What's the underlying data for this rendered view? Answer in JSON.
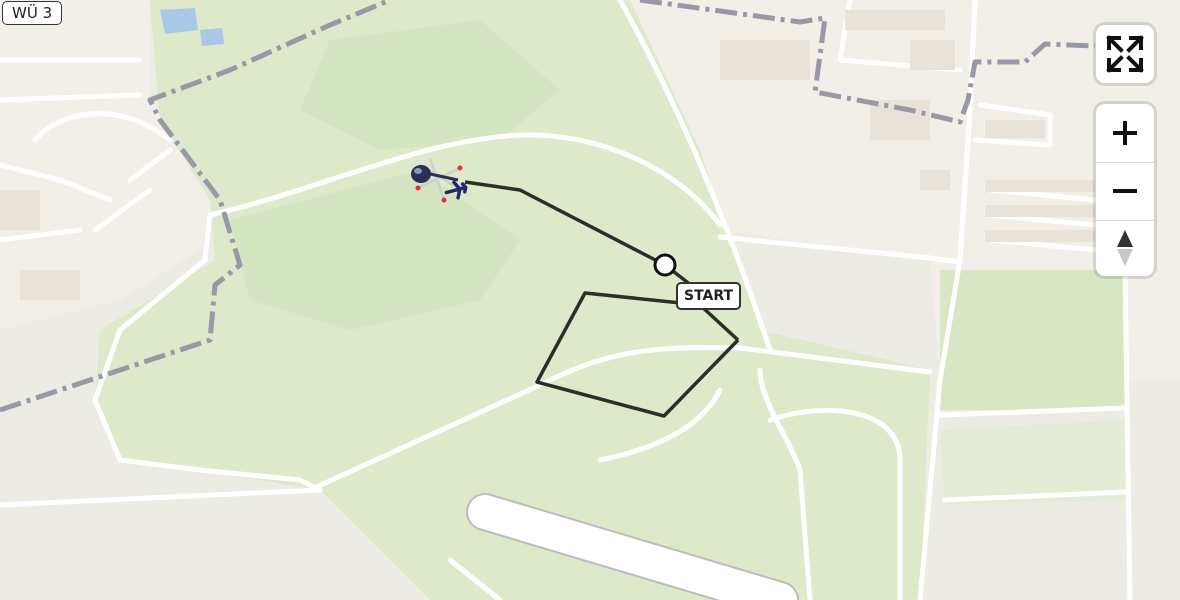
{
  "map": {
    "road_label": "WÜ 3",
    "start_label": "START",
    "colors": {
      "land": "#ecebe4",
      "urban": "#f3efe9",
      "park": "#dde9c9",
      "park_dark": "#d3e3bd",
      "road": "#ffffff",
      "boundary": "#9696a6",
      "track": "#2b2f2a",
      "water": "#a9c8e8"
    }
  },
  "aircraft": {
    "type_icon": "helicopter-icon",
    "heading_icon": "airplane-icon"
  },
  "controls": {
    "fullscreen_icon": "fullscreen-icon",
    "zoom_in_icon": "plus-icon",
    "zoom_out_icon": "minus-icon",
    "compass_icon": "compass-icon"
  }
}
